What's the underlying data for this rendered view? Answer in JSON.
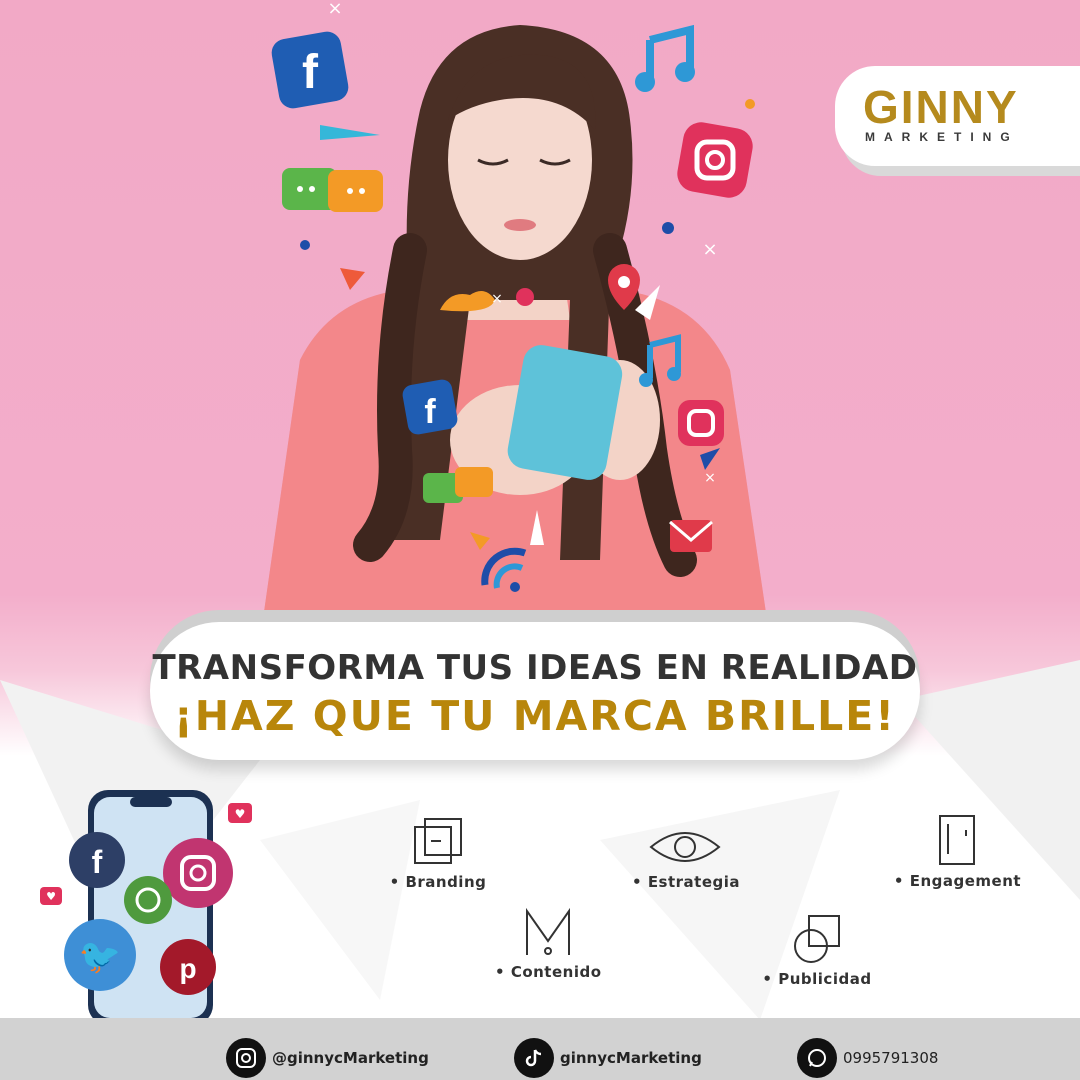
{
  "brand": {
    "name": "GINNY",
    "tagline": "MARKETING",
    "gold": "#b8860b",
    "pink": "#f2a9c6"
  },
  "banner": {
    "line1": "TRANSFORMA TUS IDEAS EN REALIDAD",
    "line2": "¡HAZ QUE TU MARCA BRILLE!"
  },
  "services": [
    {
      "label": "Branding",
      "icon": "layers-icon"
    },
    {
      "label": "Estrategia",
      "icon": "eye-icon"
    },
    {
      "label": "Engagement",
      "icon": "door-icon"
    },
    {
      "label": "Contenido",
      "icon": "m-icon"
    },
    {
      "label": "Publicidad",
      "icon": "circle-square-icon"
    }
  ],
  "footer": {
    "instagram": "@ginnycMarketing",
    "tiktok": "ginnycMarketing",
    "whatsapp": "0995791308"
  },
  "icons": [
    "facebook-icon",
    "instagram-icon",
    "whatsapp-icon",
    "twitter-icon",
    "pinterest-icon",
    "music-note-icon",
    "chat-bubble-icon",
    "location-pin-icon",
    "mail-icon",
    "wifi-icon",
    "heart-icon"
  ]
}
